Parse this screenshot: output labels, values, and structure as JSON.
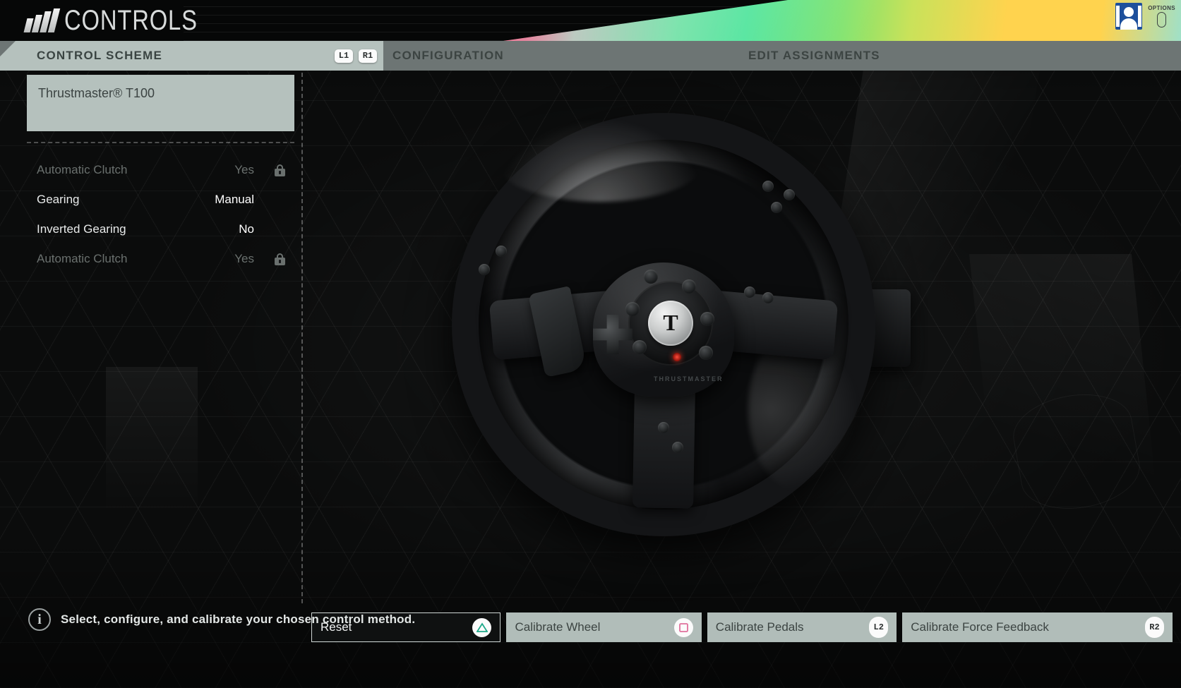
{
  "header": {
    "title": "CONTROLS",
    "logo_icon": "slanted-bars-logo",
    "profile_icon": "user-avatar-icon",
    "options_label": "OPTIONS",
    "options_glyph": "options-button-icon",
    "gradient_colors": [
      "#e8456a",
      "#35e08d",
      "#7fe36d",
      "#ffd34e"
    ]
  },
  "tabs": {
    "active": "CONTROL SCHEME",
    "items": [
      {
        "label": "CONTROL SCHEME",
        "active": true
      },
      {
        "label": "CONFIGURATION",
        "active": false
      },
      {
        "label": "EDIT ASSIGNMENTS",
        "active": false
      }
    ],
    "shoulder_badges": [
      {
        "label": "L1",
        "icon": "l1-bumper-icon"
      },
      {
        "label": "R1",
        "icon": "r1-bumper-icon"
      }
    ]
  },
  "sidebar": {
    "selected_scheme": "Thrustmaster® T100",
    "settings": [
      {
        "label": "Automatic Clutch",
        "value": "Yes",
        "locked": true
      },
      {
        "label": "Gearing",
        "value": "Manual",
        "locked": false
      },
      {
        "label": "Inverted Gearing",
        "value": "No",
        "locked": false
      },
      {
        "label": "Automatic Clutch",
        "value": "Yes",
        "locked": true
      }
    ],
    "lock_icon": "padlock-icon"
  },
  "preview": {
    "device_icon": "steering-wheel-image",
    "brand_mark": "THRUSTMASTER",
    "hub_logo": "T"
  },
  "actions": [
    {
      "label": "Reset",
      "badge": "triangle",
      "badge_label": "",
      "style": "dark",
      "icon": "triangle-button-icon"
    },
    {
      "label": "Calibrate Wheel",
      "badge": "square",
      "badge_label": "",
      "style": "light",
      "icon": "square-button-icon"
    },
    {
      "label": "Calibrate Pedals",
      "badge": "key",
      "badge_label": "L2",
      "style": "light",
      "icon": "l2-trigger-icon"
    },
    {
      "label": "Calibrate Force Feedback",
      "badge": "key",
      "badge_label": "R2",
      "style": "light",
      "icon": "r2-trigger-icon"
    }
  ],
  "footer": {
    "hint": "Select, configure, and calibrate your chosen control method.",
    "info_icon": "info-icon",
    "info_glyph": "i"
  },
  "colors": {
    "accent_light": "#b5c1bd",
    "tab_inactive_bar": "#6d7574",
    "triangle_green": "#1fa98a",
    "square_pink": "#e0719c",
    "background": "#0b0c0c"
  }
}
